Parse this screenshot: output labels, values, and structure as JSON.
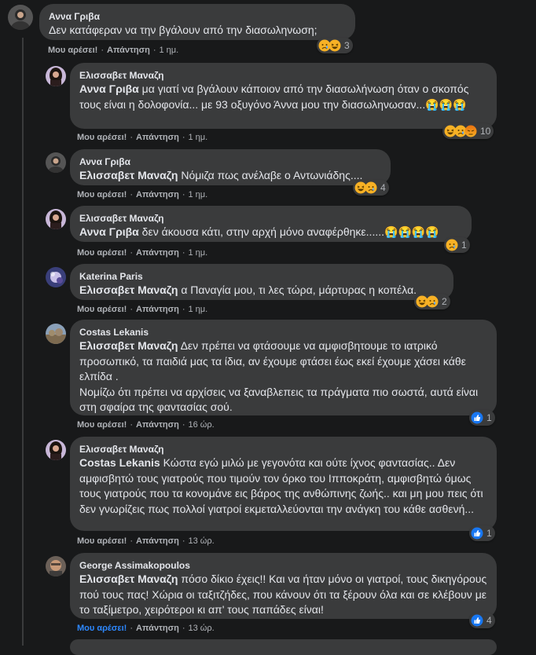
{
  "comments": [
    {
      "author": "Αννα Γριβα",
      "mention": "",
      "text": "Δεν κατάφεραν να την βγάλουν από την διασωληνωση;",
      "like": "Μου αρέσει!",
      "reply": "Απάντηση",
      "time": "1 ημ.",
      "reactions": [
        "sad-icon",
        "haha-icon"
      ],
      "reaction_count": "3",
      "liked": false
    },
    {
      "author": "Ελισσαβετ Μαναζη",
      "mention": "Αννα Γριβα",
      "text": "μα γιατί να βγάλουν κάποιον από την διασωλήνωση όταν ο σκοπός τους είναι η δολοφονία... με 93 οξυγόνο Άννα μου την διασωληνωσαν...😭😭😭",
      "like": "Μου αρέσει!",
      "reply": "Απάντηση",
      "time": "1 ημ.",
      "reactions": [
        "haha-icon",
        "sad-icon",
        "angry-icon"
      ],
      "reaction_count": "10",
      "liked": false
    },
    {
      "author": "Αννα Γριβα",
      "mention": "Ελισσαβετ Μαναζη",
      "text": "Νόμιζα πως ανέλαβε ο Αντωνιάδης....",
      "like": "Μου αρέσει!",
      "reply": "Απάντηση",
      "time": "1 ημ.",
      "reactions": [
        "haha-icon",
        "sad-icon"
      ],
      "reaction_count": "4",
      "liked": false
    },
    {
      "author": "Ελισσαβετ Μαναζη",
      "mention": "Αννα Γριβα",
      "text": "δεν άκουσα κάτι, στην αρχή μόνο αναφέρθηκε......😭😭😭😭",
      "like": "Μου αρέσει!",
      "reply": "Απάντηση",
      "time": "1 ημ.",
      "reactions": [
        "sad-icon"
      ],
      "reaction_count": "1",
      "liked": false
    },
    {
      "author": "Katerina Paris",
      "mention": "Ελισσαβετ Μαναζη",
      "text": "α Παναγία μου, τι λες τώρα, μάρτυρας η κοπέλα.",
      "like": "Μου αρέσει!",
      "reply": "Απάντηση",
      "time": "1 ημ.",
      "reactions": [
        "haha-icon",
        "sad-icon"
      ],
      "reaction_count": "2",
      "liked": false
    },
    {
      "author": "Costas Lekanis",
      "mention": "Ελισσαβετ Μαναζη",
      "text": "Δεν πρέπει να φτάσουμε να αμφισβητουμε το ιατρικό προσωπικό, τα παιδιά μας τα ίδια, αν έχουμε φτάσει έως εκεί έχουμε χάσει κάθε ελπίδα .",
      "text2": "Νομίζω ότι πρέπει να αρχίσεις να ξαναβλεπεις τα πράγματα πιο σωστά, αυτά είναι στη σφαίρα της φαντασίας σού.",
      "like": "Μου αρέσει!",
      "reply": "Απάντηση",
      "time": "16 ώρ.",
      "reactions": [
        "like-icon"
      ],
      "reaction_count": "1",
      "liked": false
    },
    {
      "author": "Ελισσαβετ Μαναζη",
      "mention": "Costas Lekanis",
      "text": "Κώστα εγώ μιλώ με γεγονότα και ούτε ίχνος φαντασίας.. Δεν αμφισβητώ τους γιατρούς που τιμούν τον όρκο του Ιπποκράτη, αμφισβητώ όμως τους γιατρούς που τα κονομάνε εις βάρος της ανθώπινης ζωής.. και μη μου πεις ότι δεν γνωρίζεις πως πολλοί γιατροί εκμεταλλεύονται την ανάγκη του κάθε ασθενή...",
      "like": "Μου αρέσει!",
      "reply": "Απάντηση",
      "time": "13 ώρ.",
      "reactions": [
        "like-icon"
      ],
      "reaction_count": "1",
      "liked": false
    },
    {
      "author": "George Assimakopoulos",
      "mention": "Ελισσαβετ Μαναζη",
      "text": "πόσο δίκιο έχεις!! Και να ήταν μόνο οι γιατροί, τους δικηγόρους πού τους πας! Χώρια οι ταξιτζήδες, που κάνουν ότι τα ξέρουν όλα και σε κλέβουν με το ταξίμετρο, χειρότεροι κι απ' τους παπάδες είναι!",
      "like": "Μου αρέσει!",
      "reply": "Απάντηση",
      "time": "13 ώρ.",
      "reactions": [
        "like-icon"
      ],
      "reaction_count": "4",
      "liked": true
    }
  ],
  "colors": {
    "background": "#18191a",
    "bubble": "#3a3b3c",
    "text": "#e4e6eb",
    "meta": "#b0b3b8",
    "like_active": "#2d88ff"
  }
}
